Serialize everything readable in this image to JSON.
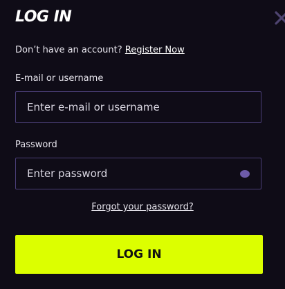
{
  "dialog": {
    "title": "LOG IN",
    "register_prompt": "Don’t have an account?",
    "register_link": "Register Now",
    "email_label": "E-mail or username",
    "email_placeholder": "Enter e-mail or username",
    "password_label": "Password",
    "password_placeholder": "Enter password",
    "forgot_link": "Forgot your password?",
    "submit_label": "LOG IN",
    "close_icon": "close-icon",
    "eye_icon": "eye-icon"
  },
  "colors": {
    "background": "#0f0c17",
    "accent": "#dcff00",
    "field_border": "#4b3f78",
    "icon": "#6d5ba9"
  }
}
